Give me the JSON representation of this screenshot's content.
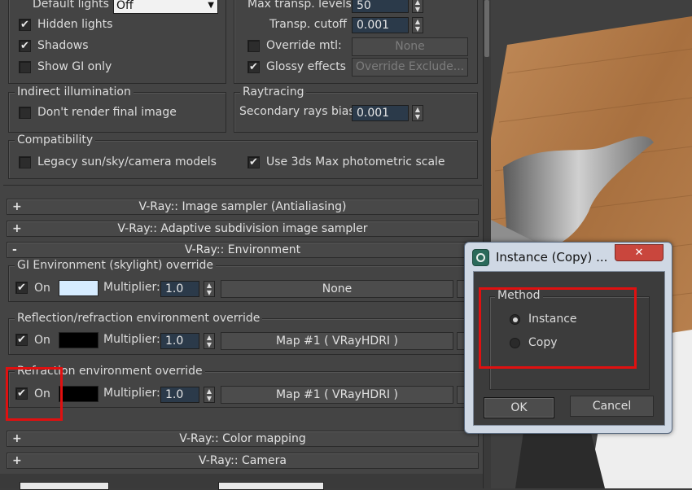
{
  "top_section": {
    "default_lights_label": "Default lights",
    "default_lights_value": "Off",
    "hidden_lights": {
      "label": "Hidden lights",
      "checked": "✔"
    },
    "shadows": {
      "label": "Shadows",
      "checked": "✔"
    },
    "show_gi_only": {
      "label": "Show GI only",
      "checked": ""
    },
    "max_transp_levels_label": "Max transp. levels",
    "max_transp_levels_value": "50",
    "transp_cutoff_label": "Transp. cutoff",
    "transp_cutoff_value": "0.001",
    "override_mtl": {
      "label": "Override mtl:",
      "checked": "",
      "button": "None"
    },
    "glossy_effects": {
      "label": "Glossy effects",
      "checked": "✔",
      "button": "Override Exclude..."
    }
  },
  "indirect_illumination": {
    "title": "Indirect illumination",
    "dont_render_final_image": {
      "label": "Don't render final image",
      "checked": ""
    }
  },
  "raytracing": {
    "title": "Raytracing",
    "secondary_rays_bias_label": "Secondary rays bias",
    "secondary_rays_bias_value": "0.001"
  },
  "compatibility": {
    "title": "Compatibility",
    "legacy": {
      "label": "Legacy sun/sky/camera models",
      "checked": ""
    },
    "photometric": {
      "label": "Use 3ds Max photometric scale",
      "checked": "✔"
    }
  },
  "rollouts": {
    "image_sampler": {
      "sign": "+",
      "label": "V-Ray:: Image sampler (Antialiasing)"
    },
    "adaptive": {
      "sign": "+",
      "label": "V-Ray:: Adaptive subdivision image sampler"
    },
    "environment": {
      "sign": "-",
      "label": "V-Ray:: Environment"
    },
    "color_mapping": {
      "sign": "+",
      "label": "V-Ray:: Color mapping"
    },
    "camera": {
      "sign": "+",
      "label": "V-Ray:: Camera"
    }
  },
  "environment": {
    "gi": {
      "title": "GI Environment (skylight) override",
      "on_label": "On",
      "checked": "✔",
      "swatch": "#d6ecff",
      "multiplier_label": "Multiplier:",
      "multiplier": "1.0",
      "map": "None"
    },
    "reflection": {
      "title": "Reflection/refraction environment override",
      "on_label": "On",
      "checked": "✔",
      "swatch": "#000000",
      "multiplier_label": "Multiplier:",
      "multiplier": "1.0",
      "map": "Map #1 ( VRayHDRI )"
    },
    "refraction": {
      "title": "Refraction environment override",
      "on_label": "On",
      "checked": "✔",
      "swatch": "#000000",
      "multiplier_label": "Multiplier:",
      "multiplier": "1.0",
      "map": "Map #1 ( VRayHDRI )"
    }
  },
  "dialog": {
    "title": "Instance (Copy) ...",
    "close": "✕",
    "method_title": "Method",
    "options": [
      {
        "label": "Instance",
        "selected": true
      },
      {
        "label": "Copy",
        "selected": false
      }
    ],
    "ok": "OK",
    "cancel": "Cancel"
  },
  "colors": {
    "panel_bg": "#444444",
    "field_bg": "#2b3a4a",
    "highlight": "#e01010",
    "dialog_frame": "#cfd8e4",
    "close_button": "#c9463d",
    "wood": "#b07a4a"
  }
}
